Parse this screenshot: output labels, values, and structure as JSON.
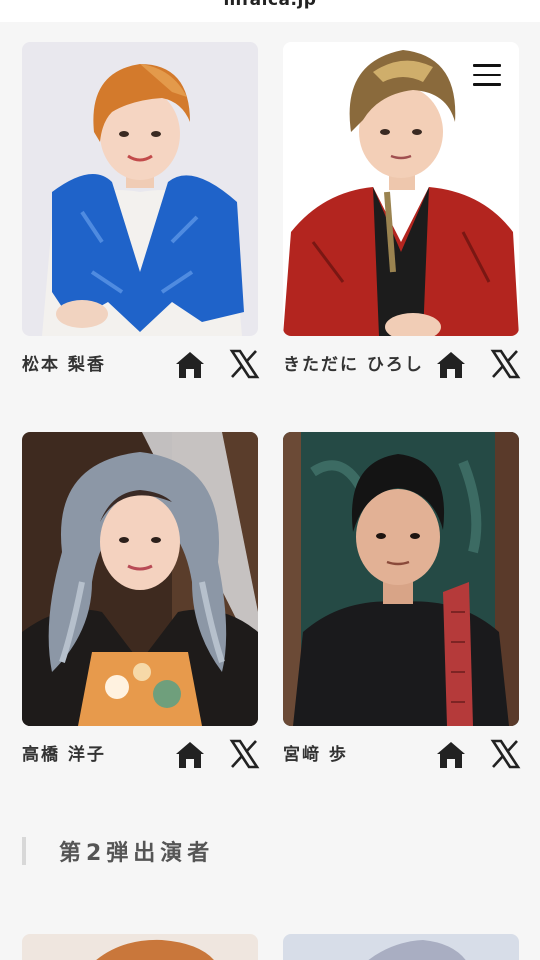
{
  "header": {
    "site_title": "mfaica.jp"
  },
  "menu": {
    "icon": "hamburger-menu-icon"
  },
  "performers": [
    {
      "name": "松本 梨香",
      "home_icon": "home-icon",
      "x_icon": "x-logo-icon"
    },
    {
      "name": "きただに ひろし",
      "home_icon": "home-icon",
      "x_icon": "x-logo-icon"
    },
    {
      "name": "高橋 洋子",
      "home_icon": "home-icon",
      "x_icon": "x-logo-icon"
    },
    {
      "name": "宮﨑 歩",
      "home_icon": "home-icon",
      "x_icon": "x-logo-icon"
    }
  ],
  "section": {
    "title": "第2弾出演者"
  },
  "colors": {
    "background": "#f6f6f6",
    "text": "#333333",
    "icon": "#222222",
    "section_bar": "#d8d8d8"
  }
}
